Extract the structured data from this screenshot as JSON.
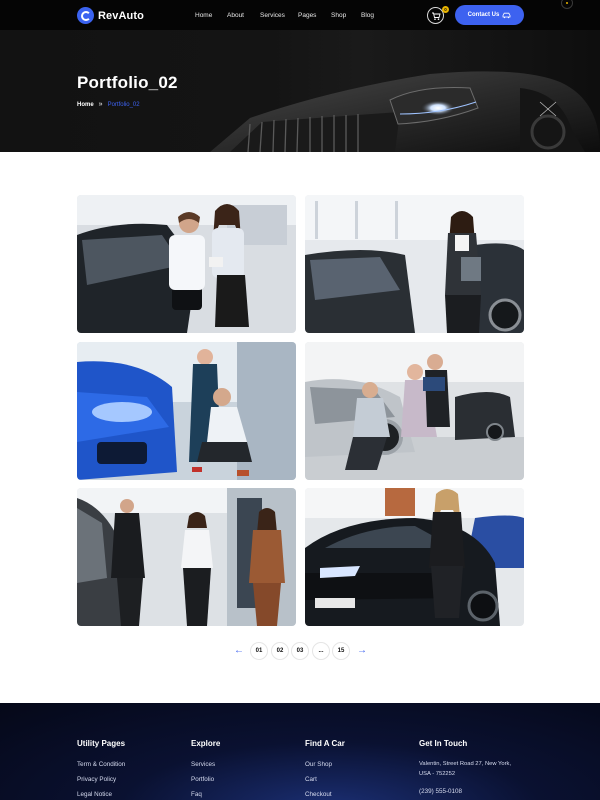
{
  "header": {
    "logo_text": "RevAuto",
    "nav": [
      "Home",
      "About",
      "Services",
      "Pages",
      "Shop",
      "Blog"
    ],
    "cart_count": "0",
    "contact_label": "Contact Us",
    "accent_color": "#3d62f0"
  },
  "hero": {
    "title": "Portfolio_02",
    "breadcrumb_home": "Home",
    "breadcrumb_separator": "»",
    "breadcrumb_current": "Portfolio_02"
  },
  "gallery": {
    "items": [
      {
        "alt": "Couple with salesperson at car in showroom"
      },
      {
        "alt": "Saleswoman with clipboard next to dark car"
      },
      {
        "alt": "Couple inspecting blue car headlight"
      },
      {
        "alt": "Couple and saleswoman checking car wheel"
      },
      {
        "alt": "Salespeople group in showroom"
      },
      {
        "alt": "Saleswoman in front of black car"
      }
    ]
  },
  "pagination": {
    "prev_icon": "arrow-left-icon",
    "pages": [
      "01",
      "02",
      "03",
      "...",
      "15"
    ],
    "next_icon": "arrow-right-icon"
  },
  "footer": {
    "columns": [
      {
        "heading": "Utility Pages",
        "links": [
          "Term & Condition",
          "Privacy Policy",
          "Legal Notice"
        ]
      },
      {
        "heading": "Explore",
        "links": [
          "Services",
          "Portfolio",
          "Faq"
        ]
      },
      {
        "heading": "Find A Car",
        "links": [
          "Our Shop",
          "Cart",
          "Checkout"
        ]
      },
      {
        "heading": "Get In Touch",
        "links": [
          "Valentin, Street Road 27, New York,",
          "USA - 752252",
          "(239) 555-0108"
        ]
      }
    ]
  }
}
